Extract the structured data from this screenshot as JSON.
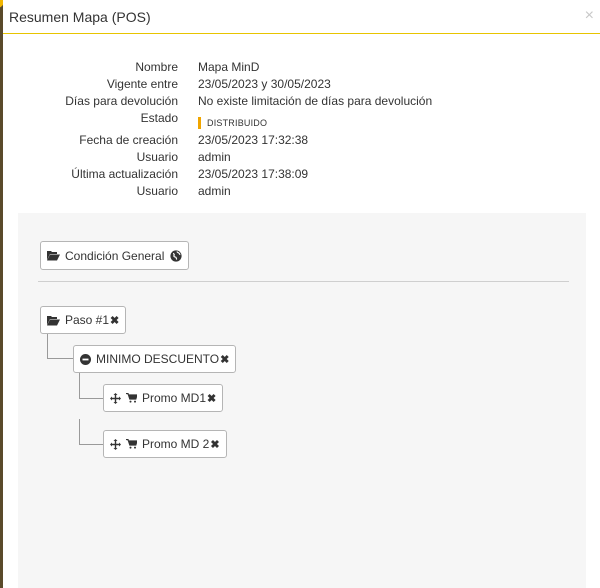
{
  "modal": {
    "title": "Resumen Mapa (POS)",
    "close": "×"
  },
  "info": {
    "nombre": {
      "label": "Nombre",
      "value": "Mapa MinD"
    },
    "vigente": {
      "label": "Vigente entre",
      "value": "23/05/2023 y 30/05/2023"
    },
    "dias": {
      "label": "Días para devolución",
      "value": "No existe limitación de días para devolución"
    },
    "estado": {
      "label": "Estado",
      "value": "DISTRIBUIDO"
    },
    "fecha_creacion": {
      "label": "Fecha de creación",
      "value": "23/05/2023 17:32:38"
    },
    "usuario1": {
      "label": "Usuario",
      "value": "admin"
    },
    "ultima": {
      "label": "Última actualización",
      "value": "23/05/2023 17:38:09"
    },
    "usuario2": {
      "label": "Usuario",
      "value": "admin"
    }
  },
  "tree": {
    "condicion_general": "Condición General",
    "paso": "Paso #1",
    "minimo": "MINIMO DESCUENTO",
    "promo1": "Promo MD1",
    "promo2": "Promo MD 2",
    "remove_glyph": "✖"
  },
  "colors": {
    "accent": "#e7c400",
    "badge": "#f0a500",
    "panel": "#f6f6f6"
  },
  "icons": [
    "folder-open-icon",
    "globe-icon",
    "remove-icon",
    "minus-circle-icon",
    "move-icon",
    "cart-icon"
  ]
}
